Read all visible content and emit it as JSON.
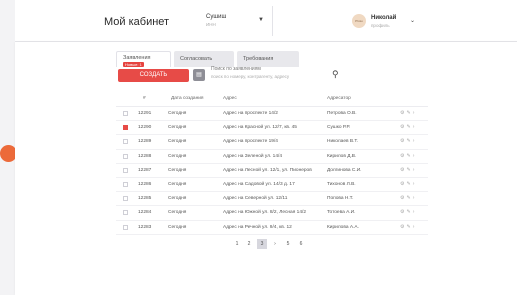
{
  "header": {
    "title": "Мой кабинет",
    "company_name": "Сушиш",
    "company_sub": "ИНН",
    "avatar_text": "Photo",
    "user_name": "Николай",
    "user_sub": "профиль"
  },
  "tabs": [
    {
      "label": "Заявления",
      "badge": "Новые: 1"
    },
    {
      "label": "Согласовать"
    },
    {
      "label": "Требования"
    }
  ],
  "toolbar": {
    "add_label": "СОЗДАТЬ",
    "filter_icon": "filter-icon",
    "search_placeholder": "Поиск по заявлениям",
    "search_hint": "поиск по номеру, контрагенту, адресу"
  },
  "table": {
    "headers": [
      "#",
      "Дата создания",
      "Адрес",
      "Адресатор"
    ],
    "rows": [
      {
        "checked": false,
        "num": "12291",
        "date": "Сегодня",
        "addr": "Адрес на проспекте 14/2",
        "person": "Петрова О.В."
      },
      {
        "checked": true,
        "num": "12290",
        "date": "Сегодня",
        "addr": "Адрес на Красной ул. 12/7, кв. 45",
        "person": "Сушко Р.Р."
      },
      {
        "checked": false,
        "num": "12289",
        "date": "Сегодня",
        "addr": "Адрес на проспекте 19/4",
        "person": "Николаев В.Т."
      },
      {
        "checked": false,
        "num": "12288",
        "date": "Сегодня",
        "addr": "Адрес на Зеленой ул. 14/4",
        "person": "Кирилов Д.В."
      },
      {
        "checked": false,
        "num": "12287",
        "date": "Сегодня",
        "addr": "Адрес на Лесной ул. 12/1, ул. Пионеров",
        "person": "Долгинова С.И."
      },
      {
        "checked": false,
        "num": "12286",
        "date": "Сегодня",
        "addr": "Адрес на Садовой ул. 14/3 д. 17",
        "person": "Тихонов Л.В."
      },
      {
        "checked": false,
        "num": "12285",
        "date": "Сегодня",
        "addr": "Адрес на Северной ул. 12/11",
        "person": "Попова Н.Т."
      },
      {
        "checked": false,
        "num": "12284",
        "date": "Сегодня",
        "addr": "Адрес на Южной ул. 8/2, Лесная 14/2",
        "person": "Тотоева А.И."
      },
      {
        "checked": false,
        "num": "12283",
        "date": "Сегодня",
        "addr": "Адрес на Речной ул. 9/4, кв. 12",
        "person": "Кирилова А.А."
      }
    ]
  },
  "pager": {
    "pages": [
      "1",
      "2",
      "3",
      "4",
      "5",
      "6"
    ],
    "prev": "‹",
    "next": "›",
    "active_page": "3"
  },
  "colors": {
    "accent": "#e74b47",
    "dot": "#ec6a3a"
  }
}
